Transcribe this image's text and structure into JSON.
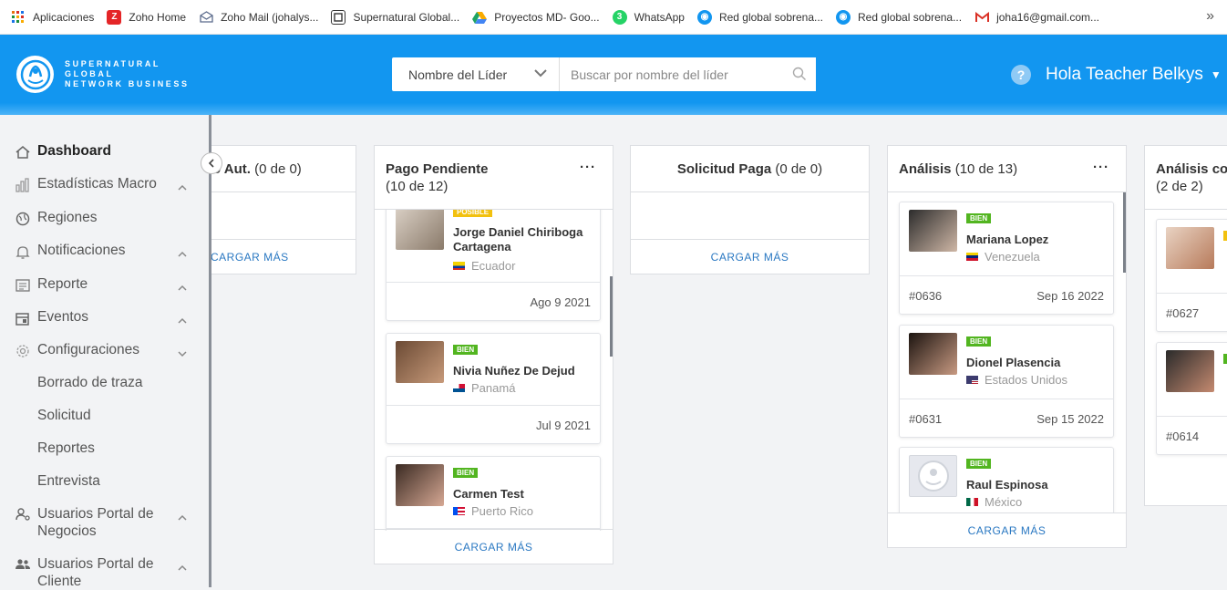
{
  "bookmarks": [
    {
      "label": "Aplicaciones",
      "icon": "apps-grid-icon",
      "color": "#e8710a"
    },
    {
      "label": "Zoho Home",
      "icon": "zoho-icon",
      "color": "#e42527"
    },
    {
      "label": "Zoho Mail (johalys...",
      "icon": "mail-icon",
      "color": "#5b6b8c"
    },
    {
      "label": "Supernatural Global...",
      "icon": "supernatural-icon",
      "color": "#333333"
    },
    {
      "label": "Proyectos MD- Goo...",
      "icon": "google-drive-icon",
      "color": "#1fa463"
    },
    {
      "label": "WhatsApp",
      "icon": "whatsapp-icon",
      "color": "#25d366"
    },
    {
      "label": "Red global sobrena...",
      "icon": "globe-icon",
      "color": "#1296f0"
    },
    {
      "label": "Red global sobrena...",
      "icon": "globe-icon",
      "color": "#1296f0"
    },
    {
      "label": "joha16@gmail.com...",
      "icon": "gmail-icon",
      "color": "#d93025"
    }
  ],
  "whatsapp_badge": "3",
  "header": {
    "logo_lines": [
      "SUPERNATURAL",
      "GLOBAL",
      "NETWORK BUSINESS"
    ],
    "search_select": "Nombre del Líder",
    "search_placeholder": "Buscar por nombre del líder",
    "help": "?",
    "greeting": "Hola Teacher Belkys"
  },
  "sidebar": {
    "items": [
      {
        "label": "Dashboard",
        "icon": "home-icon"
      },
      {
        "label": "Estadísticas Macro",
        "icon": "bar-chart-icon"
      },
      {
        "label": "Regiones",
        "icon": "globe-icon"
      },
      {
        "label": "Notificaciones",
        "icon": "bell-icon"
      },
      {
        "label": "Reporte",
        "icon": "report-icon"
      },
      {
        "label": "Eventos",
        "icon": "calendar-icon"
      },
      {
        "label": "Configuraciones",
        "icon": "gear-icon"
      },
      {
        "label": "Usuarios Portal de Negocios",
        "icon": "users-gear-icon"
      },
      {
        "label": "Usuarios Portal de Cliente",
        "icon": "users-icon"
      }
    ],
    "subitems": [
      "Borrado de traza",
      "Solicitud",
      "Reportes",
      "Entrevista"
    ]
  },
  "board": {
    "load_more": "CARGAR MÁS",
    "columns": [
      {
        "title": "...o Aut.",
        "title_visible": "o Aut.",
        "count": "(0 de 0)"
      },
      {
        "title": "Pago Pendiente",
        "count": "(10 de 12)"
      },
      {
        "title": "Solicitud Paga",
        "count": "(0 de 0)"
      },
      {
        "title": "Análisis",
        "count": "(10 de 13)"
      },
      {
        "title": "Análisis co",
        "count": "(2 de 2)"
      }
    ],
    "pago_cards": [
      {
        "badge": "POSIBLE",
        "name": "Jorge Daniel Chiriboga Cartagena",
        "country": "Ecuador",
        "date": "Ago 9 2021"
      },
      {
        "badge": "BIEN",
        "name": "Nivia Nuñez De Dejud",
        "country": "Panamá",
        "date": "Jul 9 2021"
      },
      {
        "badge": "BIEN",
        "name": "Carmen Test",
        "country": "Puerto Rico",
        "date": ""
      }
    ],
    "analisis_cards": [
      {
        "badge": "BIEN",
        "name": "Mariana Lopez",
        "country": "Venezuela",
        "id": "#0636",
        "date": "Sep 16 2022"
      },
      {
        "badge": "BIEN",
        "name": "Dionel Plasencia",
        "country": "Estados Unidos",
        "id": "#0631",
        "date": "Sep 15 2022"
      },
      {
        "badge": "BIEN",
        "name": "Raul Espinosa",
        "country": "México",
        "id": "",
        "date": ""
      }
    ],
    "analisis2_cards": [
      {
        "id": "#0627"
      },
      {
        "id": "#0614"
      }
    ]
  },
  "colors": {
    "brand_blue": "#1296f0",
    "badge_green": "#52b520",
    "badge_yellow": "#f2c10f",
    "link_blue": "#2a78c2"
  }
}
